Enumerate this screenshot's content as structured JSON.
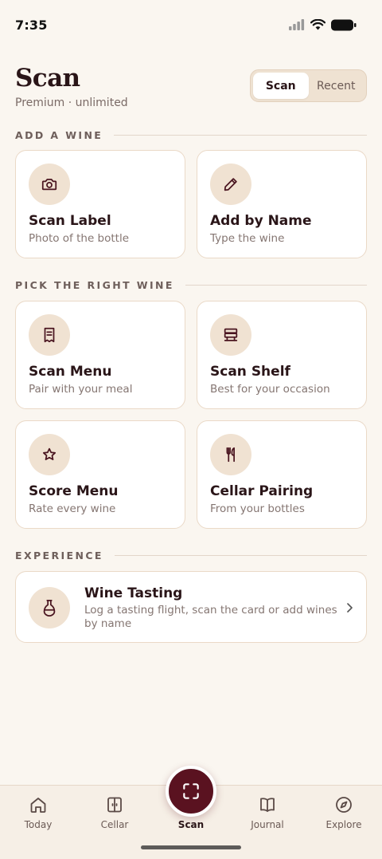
{
  "status_bar": {
    "time": "7:35"
  },
  "header": {
    "title": "Scan",
    "subtitle": "Premium · unlimited",
    "segments": [
      {
        "label": "Scan",
        "active": true
      },
      {
        "label": "Recent",
        "active": false
      }
    ]
  },
  "sections": {
    "add_a_wine": "ADD A WINE",
    "pick_the_right_wine": "PICK THE RIGHT WINE",
    "experience": "EXPERIENCE"
  },
  "cards": {
    "scan_label": {
      "title": "Scan Label",
      "subtitle": "Photo of the bottle",
      "icon": "camera-icon"
    },
    "add_by_name": {
      "title": "Add by Name",
      "subtitle": "Type the wine",
      "icon": "pencil-icon"
    },
    "scan_menu": {
      "title": "Scan Menu",
      "subtitle": "Pair with your meal",
      "icon": "receipt-icon"
    },
    "scan_shelf": {
      "title": "Scan Shelf",
      "subtitle": "Best for your occasion",
      "icon": "shelf-icon"
    },
    "score_menu": {
      "title": "Score Menu",
      "subtitle": "Rate every wine",
      "icon": "star-icon"
    },
    "cellar_pairing": {
      "title": "Cellar Pairing",
      "subtitle": "From your bottles",
      "icon": "fork-knife-icon"
    }
  },
  "wine_tasting": {
    "title": "Wine Tasting",
    "description": "Log a tasting flight, scan the card or add wines by name",
    "icon": "flask-icon"
  },
  "tab_bar": {
    "tabs": [
      {
        "label": "Today",
        "icon": "home-icon"
      },
      {
        "label": "Cellar",
        "icon": "cellar-icon"
      },
      {
        "label": "Scan",
        "icon": "scan-icon",
        "active": true
      },
      {
        "label": "Journal",
        "icon": "book-icon"
      },
      {
        "label": "Explore",
        "icon": "compass-icon"
      }
    ]
  },
  "colors": {
    "background": "#faf6f0",
    "accent": "#5a1220",
    "icon_fill": "#f0e2d2",
    "card_border": "#ead9c7"
  }
}
